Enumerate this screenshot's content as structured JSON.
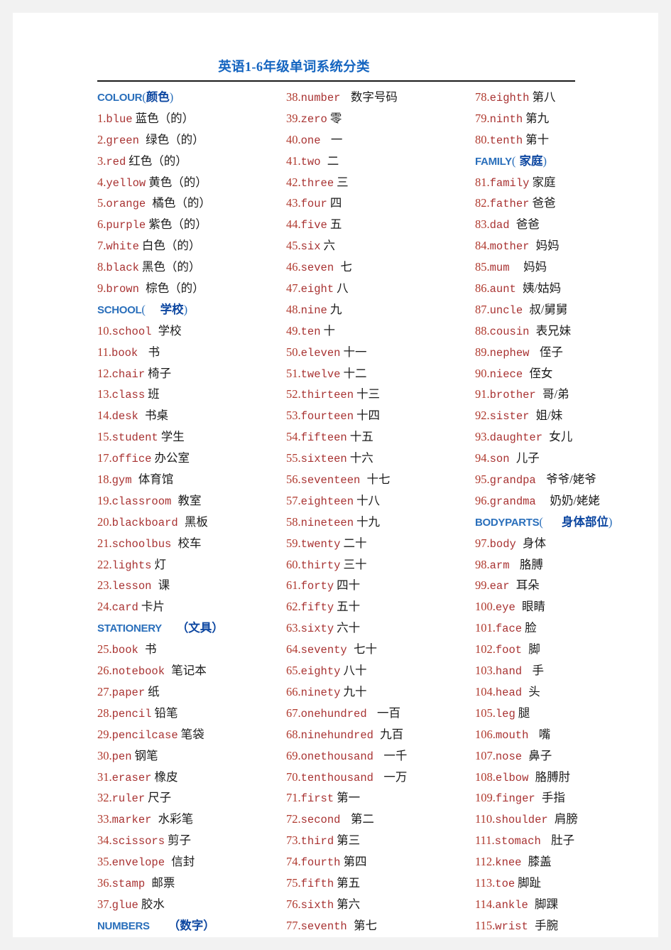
{
  "document": {
    "title": "英语1-6年级单词系统分类",
    "title_color": "#1565c0",
    "word_color": "#a83232",
    "number_color": "#b03a2e",
    "chinese_color": "#1a1a1a",
    "header_latin_color": "#2a6fbb",
    "header_chinese_color": "#0d47a1",
    "page_background": "#ffffff",
    "canvas_background": "#f2f2f2"
  },
  "columns": [
    {
      "id": "column-1",
      "entries": [
        {
          "kind": "header",
          "latin": "COLOUR",
          "open": "(",
          "cn": "颜色",
          "close": ")",
          "pad": ""
        },
        {
          "kind": "word",
          "num": "1.",
          "word": "blue",
          "cn": "蓝色（的）",
          "bold_first": true,
          "gap": ""
        },
        {
          "kind": "word",
          "num": "2.",
          "word": "green",
          "cn": "绿色（的）",
          "gap": " "
        },
        {
          "kind": "word",
          "num": "3.",
          "word": "red",
          "cn": "红色（的）",
          "gap": ""
        },
        {
          "kind": "word",
          "num": "4.",
          "word": "yellow",
          "cn": "黄色（的）",
          "gap": ""
        },
        {
          "kind": "word",
          "num": "5.",
          "word": "orange",
          "cn": "橘色（的）",
          "gap": " "
        },
        {
          "kind": "word",
          "num": "6.",
          "word": "purple",
          "cn": "紫色（的）",
          "gap": ""
        },
        {
          "kind": "word",
          "num": "7.",
          "word": "white",
          "cn": "白色（的）",
          "gap": ""
        },
        {
          "kind": "word",
          "num": "8.",
          "word": "black",
          "cn": "黑色（的）",
          "gap": ""
        },
        {
          "kind": "word",
          "num": "9.",
          "word": "brown",
          "cn": "棕色（的）",
          "gap": " "
        },
        {
          "kind": "header",
          "latin": "SCHOOL",
          "open": "(",
          "cn": "学校",
          "close": ")",
          "pad": "    "
        },
        {
          "kind": "word",
          "num": "10.",
          "word": "school",
          "cn": "学校",
          "gap": " "
        },
        {
          "kind": "word",
          "num": "11.",
          "word": "book",
          "cn": "书",
          "gap": "  "
        },
        {
          "kind": "word",
          "num": "12.",
          "word": "chair",
          "cn": "椅子",
          "gap": ""
        },
        {
          "kind": "word",
          "num": "13.",
          "word": "class",
          "cn": "班",
          "gap": ""
        },
        {
          "kind": "word",
          "num": "14.",
          "word": "desk",
          "cn": "书桌",
          "gap": " "
        },
        {
          "kind": "word",
          "num": "15.",
          "word": "student",
          "cn": "学生",
          "gap": ""
        },
        {
          "kind": "word",
          "num": "17.",
          "word": "office",
          "cn": "办公室",
          "gap": ""
        },
        {
          "kind": "word",
          "num": "18.",
          "word": "gym",
          "cn": "体育馆",
          "gap": " "
        },
        {
          "kind": "word",
          "num": "19.",
          "word": "classroom",
          "cn": "教室",
          "gap": " "
        },
        {
          "kind": "word",
          "num": "20.",
          "word": "blackboard",
          "cn": "黑板",
          "gap": " "
        },
        {
          "kind": "word",
          "num": "21.",
          "word": "schoolbus",
          "cn": "校车",
          "gap": " "
        },
        {
          "kind": "word",
          "num": "22.",
          "word": "lights",
          "cn": "灯",
          "gap": ""
        },
        {
          "kind": "word",
          "num": "23.",
          "word": "lesson",
          "cn": "课",
          "gap": " "
        },
        {
          "kind": "word",
          "num": "24.",
          "word": "card",
          "cn": "卡片",
          "gap": ""
        },
        {
          "kind": "header",
          "latin": "STATIONERY",
          "open": "",
          "cn": "（文具）",
          "close": "",
          "pad": "    "
        },
        {
          "kind": "word",
          "num": "25.",
          "word": "book",
          "cn": "书",
          "gap": " "
        },
        {
          "kind": "word",
          "num": "26.",
          "word": "notebook",
          "cn": "笔记本",
          "gap": " "
        },
        {
          "kind": "word",
          "num": "27.",
          "word": "paper",
          "cn": "纸",
          "gap": ""
        },
        {
          "kind": "word",
          "num": "28.",
          "word": "pencil",
          "cn": "铅笔",
          "gap": ""
        },
        {
          "kind": "word",
          "num": "29.",
          "word": "pencilcase",
          "cn": "笔袋",
          "gap": ""
        },
        {
          "kind": "word",
          "num": "30.",
          "word": "pen",
          "cn": "钢笔",
          "gap": ""
        },
        {
          "kind": "word",
          "num": "31.",
          "word": "eraser",
          "cn": "橡皮",
          "gap": ""
        },
        {
          "kind": "word",
          "num": "32.",
          "word": "ruler",
          "cn": "尺子",
          "gap": ""
        },
        {
          "kind": "word",
          "num": "33.",
          "word": "marker",
          "cn": "水彩笔",
          "gap": " "
        },
        {
          "kind": "word",
          "num": "34.",
          "word": "scissors",
          "cn": "剪子",
          "gap": ""
        },
        {
          "kind": "word",
          "num": "35.",
          "word": "envelope",
          "cn": "信封",
          "gap": " "
        },
        {
          "kind": "word",
          "num": "36.",
          "word": "stamp",
          "cn": "邮票",
          "gap": " "
        },
        {
          "kind": "word",
          "num": "37.",
          "word": "glue",
          "cn": "胶水",
          "gap": ""
        },
        {
          "kind": "header",
          "latin": "NUMBERS",
          "open": "",
          "cn": "（数字）",
          "close": "",
          "pad": "     "
        }
      ]
    },
    {
      "id": "column-2",
      "entries": [
        {
          "kind": "word",
          "num": "38.",
          "word": "number",
          "cn": "数字号码",
          "gap": "  "
        },
        {
          "kind": "word",
          "num": "39.",
          "word": "zero",
          "cn": "零",
          "gap": ""
        },
        {
          "kind": "word",
          "num": "40.",
          "word": "one",
          "cn": "一",
          "gap": "  "
        },
        {
          "kind": "word",
          "num": "41.",
          "word": "two",
          "cn": "二",
          "gap": " "
        },
        {
          "kind": "word",
          "num": "42.",
          "word": "three",
          "cn": "三",
          "gap": ""
        },
        {
          "kind": "word",
          "num": "43.",
          "word": "four",
          "cn": "四",
          "gap": ""
        },
        {
          "kind": "word",
          "num": "44.",
          "word": "five",
          "cn": "五",
          "gap": ""
        },
        {
          "kind": "word",
          "num": "45.",
          "word": "six",
          "cn": "六",
          "gap": ""
        },
        {
          "kind": "word",
          "num": "46.",
          "word": "seven",
          "cn": "七",
          "gap": " "
        },
        {
          "kind": "word",
          "num": "47.",
          "word": "eight",
          "cn": "八",
          "gap": ""
        },
        {
          "kind": "word",
          "num": "48.",
          "word": "nine",
          "cn": "九",
          "gap": ""
        },
        {
          "kind": "word",
          "num": "49.",
          "word": "ten",
          "cn": "十",
          "gap": ""
        },
        {
          "kind": "word",
          "num": "50.",
          "word": "eleven",
          "cn": "十一",
          "gap": ""
        },
        {
          "kind": "word",
          "num": "51.",
          "word": "twelve",
          "cn": "十二",
          "gap": ""
        },
        {
          "kind": "word",
          "num": "52.",
          "word": "thirteen",
          "cn": "十三",
          "gap": ""
        },
        {
          "kind": "word",
          "num": "53.",
          "word": "fourteen",
          "cn": "十四",
          "gap": ""
        },
        {
          "kind": "word",
          "num": "54.",
          "word": "fifteen",
          "cn": "十五",
          "gap": ""
        },
        {
          "kind": "word",
          "num": "55.",
          "word": "sixteen",
          "cn": "十六",
          "gap": ""
        },
        {
          "kind": "word",
          "num": "56.",
          "word": "seventeen",
          "cn": "十七",
          "gap": " "
        },
        {
          "kind": "word",
          "num": "57.",
          "word": "eighteen",
          "cn": "十八",
          "gap": ""
        },
        {
          "kind": "word",
          "num": "58.",
          "word": "nineteen",
          "cn": "十九",
          "gap": ""
        },
        {
          "kind": "word",
          "num": "59.",
          "word": "twenty",
          "cn": "二十",
          "gap": ""
        },
        {
          "kind": "word",
          "num": "60.",
          "word": "thirty",
          "cn": "三十",
          "gap": ""
        },
        {
          "kind": "word",
          "num": "61.",
          "word": "forty",
          "cn": "四十",
          "gap": ""
        },
        {
          "kind": "word",
          "num": "62.",
          "word": "fifty",
          "cn": "五十",
          "gap": ""
        },
        {
          "kind": "word",
          "num": "63.",
          "word": "sixty",
          "cn": "六十",
          "gap": ""
        },
        {
          "kind": "word",
          "num": "64.",
          "word": "seventy",
          "cn": "七十",
          "gap": " "
        },
        {
          "kind": "word",
          "num": "65.",
          "word": "eighty",
          "cn": "八十",
          "gap": ""
        },
        {
          "kind": "word",
          "num": "66.",
          "word": "ninety",
          "cn": "九十",
          "gap": ""
        },
        {
          "kind": "word",
          "num": "67.",
          "word": "onehundred",
          "cn": "一百",
          "gap": "  "
        },
        {
          "kind": "word",
          "num": "68.",
          "word": "ninehundred",
          "cn": "九百",
          "gap": " "
        },
        {
          "kind": "word",
          "num": "69.",
          "word": "onethousand",
          "cn": "一千",
          "gap": "  "
        },
        {
          "kind": "word",
          "num": "70.",
          "word": "tenthousand",
          "cn": "一万",
          "gap": "  "
        },
        {
          "kind": "word",
          "num": "71.",
          "word": "first",
          "cn": "第一",
          "gap": ""
        },
        {
          "kind": "word",
          "num": "72.",
          "word": "second",
          "cn": "第二",
          "gap": "  "
        },
        {
          "kind": "word",
          "num": "73.",
          "word": "third",
          "cn": "第三",
          "gap": ""
        },
        {
          "kind": "word",
          "num": "74.",
          "word": "fourth",
          "cn": "第四",
          "gap": ""
        },
        {
          "kind": "word",
          "num": "75.",
          "word": "fifth",
          "cn": "第五",
          "gap": ""
        },
        {
          "kind": "word",
          "num": "76.",
          "word": "sixth",
          "cn": "第六",
          "gap": ""
        },
        {
          "kind": "word",
          "num": "77.",
          "word": "seventh",
          "cn": "第七",
          "gap": " "
        }
      ]
    },
    {
      "id": "column-3",
      "entries": [
        {
          "kind": "word",
          "num": "78.",
          "word": "eighth",
          "cn": "第八",
          "gap": ""
        },
        {
          "kind": "word",
          "num": "79.",
          "word": "ninth",
          "cn": "第九",
          "gap": ""
        },
        {
          "kind": "word",
          "num": "80.",
          "word": "tenth",
          "cn": "第十",
          "gap": ""
        },
        {
          "kind": "header",
          "latin": "FAMILY",
          "open": "(",
          "cn": "家庭",
          "close": ")",
          "pad": " "
        },
        {
          "kind": "word",
          "num": "81.",
          "word": "family",
          "cn": "家庭",
          "gap": ""
        },
        {
          "kind": "word",
          "num": "82.",
          "word": "father",
          "cn": "爸爸",
          "gap": ""
        },
        {
          "kind": "word",
          "num": "83.",
          "word": "dad",
          "cn": "爸爸",
          "gap": " "
        },
        {
          "kind": "word",
          "num": "84.",
          "word": "mother",
          "cn": "妈妈",
          "gap": " "
        },
        {
          "kind": "word",
          "num": "85.",
          "word": "mum",
          "cn": "妈妈",
          "gap": "   "
        },
        {
          "kind": "word",
          "num": "86.",
          "word": "aunt",
          "cn": "姨/姑妈",
          "gap": " "
        },
        {
          "kind": "word",
          "num": "87.",
          "word": "uncle",
          "cn": "叔/舅舅",
          "gap": " "
        },
        {
          "kind": "word",
          "num": "88.",
          "word": "cousin",
          "cn": "表兄妹",
          "gap": " "
        },
        {
          "kind": "word",
          "num": "89.",
          "word": "nephew",
          "cn": "侄子",
          "gap": "  "
        },
        {
          "kind": "word",
          "num": "90.",
          "word": "niece",
          "cn": "侄女",
          "gap": " "
        },
        {
          "kind": "word",
          "num": "91.",
          "word": "brother",
          "cn": "哥/弟",
          "gap": " "
        },
        {
          "kind": "word",
          "num": "92.",
          "word": "sister",
          "cn": "姐/妹",
          "gap": " "
        },
        {
          "kind": "word",
          "num": "93.",
          "word": "daughter",
          "cn": "女儿",
          "gap": " "
        },
        {
          "kind": "word",
          "num": "94.",
          "word": "son",
          "cn": "儿子",
          "gap": " "
        },
        {
          "kind": "word",
          "num": "95.",
          "word": "grandpa",
          "cn": "爷爷/姥爷",
          "gap": "  "
        },
        {
          "kind": "word",
          "num": "96.",
          "word": "grandma",
          "cn": "奶奶/姥姥",
          "gap": "   "
        },
        {
          "kind": "header",
          "latin": "BODYPARTS",
          "open": "(",
          "cn": "身体部位",
          "close": ")",
          "pad": "     "
        },
        {
          "kind": "word",
          "num": "97.",
          "word": "body",
          "cn": "身体",
          "gap": " "
        },
        {
          "kind": "word",
          "num": "98.",
          "word": "arm",
          "cn": "胳膊",
          "gap": "  "
        },
        {
          "kind": "word",
          "num": "99.",
          "word": "ear",
          "cn": "耳朵",
          "gap": " "
        },
        {
          "kind": "word",
          "num": "100.",
          "word": "eye",
          "cn": "眼睛",
          "gap": " "
        },
        {
          "kind": "word",
          "num": "101.",
          "word": "face",
          "cn": "脸",
          "gap": ""
        },
        {
          "kind": "word",
          "num": "102.",
          "word": "foot",
          "cn": "脚",
          "gap": " "
        },
        {
          "kind": "word",
          "num": "103.",
          "word": "hand",
          "cn": "手",
          "gap": "  "
        },
        {
          "kind": "word",
          "num": "104.",
          "word": "head",
          "cn": "头",
          "gap": " "
        },
        {
          "kind": "word",
          "num": "105.",
          "word": "leg",
          "cn": "腿",
          "gap": ""
        },
        {
          "kind": "word",
          "num": "106.",
          "word": "mouth",
          "cn": "嘴",
          "gap": "  "
        },
        {
          "kind": "word",
          "num": "107.",
          "word": "nose",
          "cn": "鼻子",
          "gap": " "
        },
        {
          "kind": "word",
          "num": "108.",
          "word": "elbow",
          "cn": "胳膊肘",
          "gap": " "
        },
        {
          "kind": "word",
          "num": "109.",
          "word": "finger",
          "cn": "手指",
          "gap": " "
        },
        {
          "kind": "word",
          "num": "110.",
          "word": "shoulder",
          "cn": "肩膀",
          "gap": " "
        },
        {
          "kind": "word",
          "num": "111.",
          "word": "stomach",
          "cn": "肚子",
          "gap": "  "
        },
        {
          "kind": "word",
          "num": "112.",
          "word": "knee",
          "cn": "膝盖",
          "gap": " "
        },
        {
          "kind": "word",
          "num": "113.",
          "word": "toe",
          "cn": "脚趾",
          "gap": ""
        },
        {
          "kind": "word",
          "num": "114.",
          "word": "ankle",
          "cn": "脚踝",
          "gap": " "
        },
        {
          "kind": "word",
          "num": "115.",
          "word": "wrist",
          "cn": "手腕",
          "gap": " "
        }
      ]
    }
  ]
}
